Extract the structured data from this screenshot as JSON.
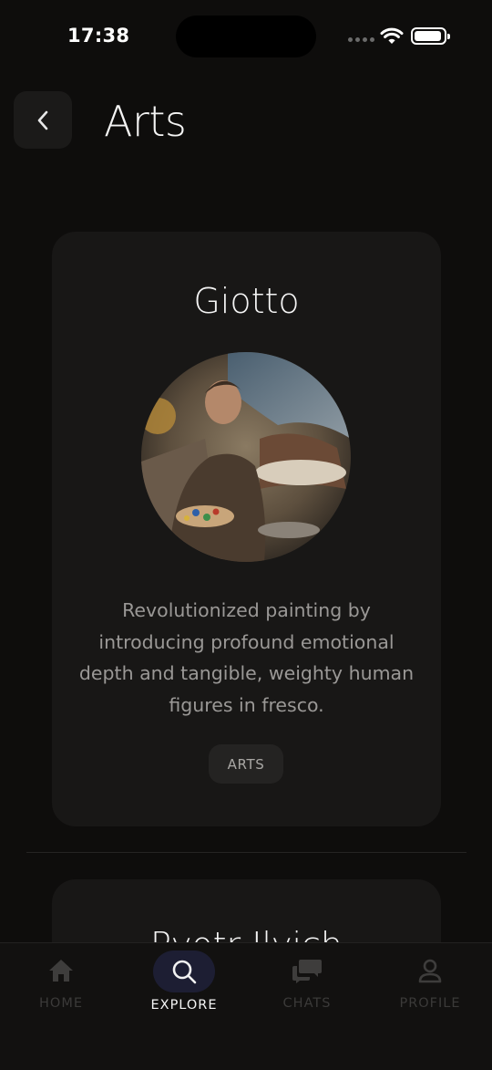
{
  "status_bar": {
    "time": "17:38"
  },
  "header": {
    "title": "Arts"
  },
  "cards": [
    {
      "name": "Giotto",
      "description": "Revolutionized painting by introducing profound emotional depth and tangible, weighty human figures in fresco.",
      "tag": "ARTS"
    },
    {
      "name": "Pyotr Ilyich"
    }
  ],
  "tab_bar": {
    "tabs": [
      {
        "label": "HOME",
        "icon": "home-icon",
        "active": false
      },
      {
        "label": "EXPLORE",
        "icon": "search-icon",
        "active": true
      },
      {
        "label": "CHATS",
        "icon": "chat-icon",
        "active": false
      },
      {
        "label": "PROFILE",
        "icon": "profile-icon",
        "active": false
      }
    ]
  },
  "colors": {
    "background": "#0e0d0c",
    "card": "#181716",
    "active_tab_pill": "#1d1e33",
    "text_primary": "#f4f4f4",
    "text_secondary": "#9a9896"
  }
}
